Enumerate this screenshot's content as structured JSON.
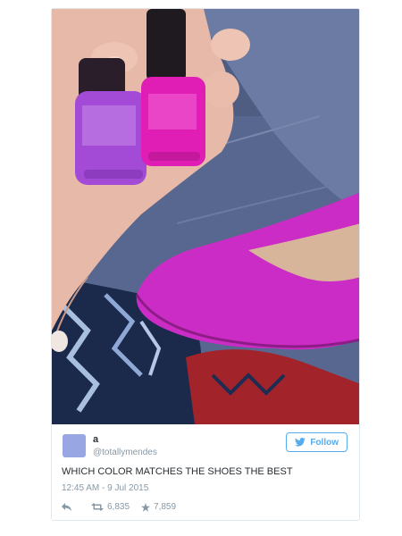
{
  "tweet": {
    "author_name": "a",
    "author_handle": "@totallymendes",
    "follow_label": "Follow",
    "text": "WHICH COLOR MATCHES THE SHOES THE BEST",
    "timestamp": "12:45 AM - 9 Jul 2015",
    "retweets": "6,835",
    "favorites": "7,859"
  },
  "icons": {
    "reply": "reply-icon",
    "retweet": "retweet-icon",
    "favorite": "star-icon",
    "bird": "twitter-bird-icon"
  },
  "colors": {
    "accent": "#55acee",
    "avatar": "#98a7e3",
    "text": "#292f33",
    "muted": "#8899a6"
  }
}
